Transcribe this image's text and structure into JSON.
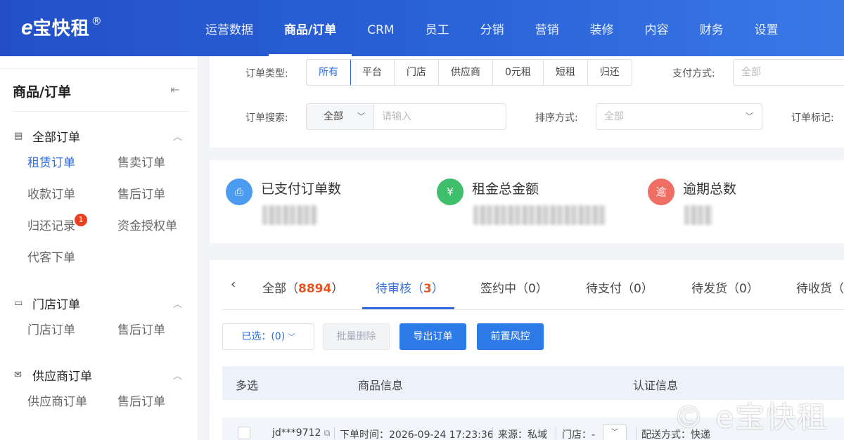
{
  "brand": {
    "logo_e": "e",
    "logo_text": "宝快租",
    "logo_mark": "®"
  },
  "nav": [
    "运营数据",
    "商品/订单",
    "CRM",
    "员工",
    "分销",
    "营销",
    "装修",
    "内容",
    "财务",
    "设置"
  ],
  "nav_active": "商品/订单",
  "sidebar": {
    "title": "商品/订单",
    "collapse_icon": "collapse-left-icon",
    "groups": [
      {
        "label": "全部订单",
        "icon": "document-list-icon",
        "items": [
          "租赁订单",
          "售卖订单",
          "收款订单",
          "售后订单",
          "归还记录",
          "资金授权单",
          "代客下单"
        ]
      },
      {
        "label": "门店订单",
        "icon": "window-icon",
        "items": [
          "门店订单",
          "售后订单"
        ]
      },
      {
        "label": "供应商订单",
        "icon": "envelope-icon",
        "items": [
          "供应商订单",
          "售后订单"
        ]
      }
    ],
    "active_item": "租赁订单",
    "badge": "1"
  },
  "filters": {
    "order_type_label": "订单类型:",
    "order_types": [
      "所有",
      "平台",
      "门店",
      "供应商",
      "0元租",
      "短租",
      "归还"
    ],
    "payment_label": "支付方式:",
    "payment_placeholder": "全部",
    "search_label": "订单搜索:",
    "search_scope": "全部",
    "search_placeholder": "请输入",
    "sort_label": "排序方式:",
    "sort_placeholder": "全部",
    "mark_label": "订单标记:"
  },
  "stats": [
    {
      "label": "已支付订单数",
      "icon_glyph": "⎙",
      "icon": "bag-icon",
      "color": "#4b9cf0"
    },
    {
      "label": "租金总金额",
      "icon_glyph": "¥",
      "icon": "yen-icon",
      "color": "#3fbf6b"
    },
    {
      "label": "逾期总数",
      "icon_glyph": "逾",
      "icon": "overdue-icon",
      "color": "#ef6e64"
    }
  ],
  "tabs": {
    "prev_icon": "chevron-left-icon",
    "items": [
      {
        "label": "全部",
        "count": "8894"
      },
      {
        "label": "待审核",
        "count": "3"
      },
      {
        "label": "签约中",
        "count": "0"
      },
      {
        "label": "待支付",
        "count": "0"
      },
      {
        "label": "待发货",
        "count": "0"
      },
      {
        "label": "待收货",
        "count": ""
      }
    ],
    "active": "待审核"
  },
  "actions": {
    "selected": "已选：(0)",
    "batch_delete": "批量删除",
    "export": "导出订单",
    "risk_control": "前置风控"
  },
  "table": {
    "headers": [
      "多选",
      "商品信息",
      "认证信息"
    ]
  },
  "row": {
    "user": "jd***9712",
    "order_time": "下单时间：2026-09-24 17:23:36",
    "source": "来源：私域",
    "store": "门店：-",
    "delivery": "配送方式：快递"
  },
  "watermark": "© e宝快租"
}
